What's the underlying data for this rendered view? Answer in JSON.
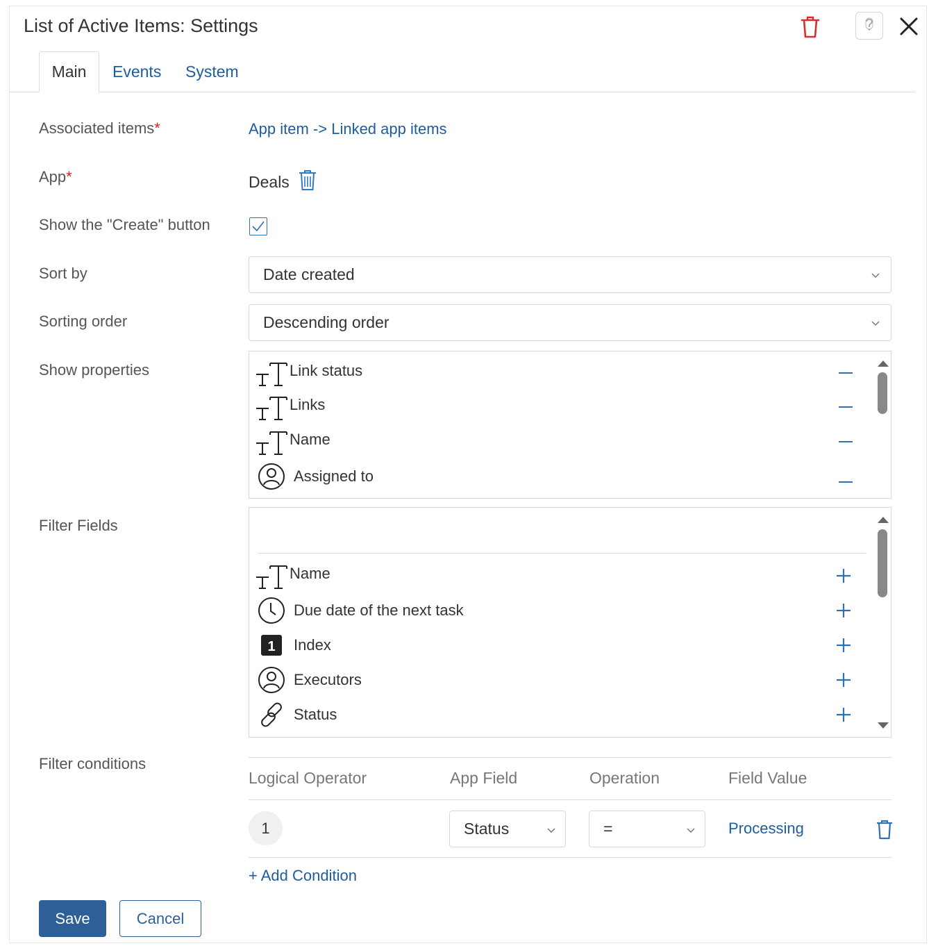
{
  "dialog": {
    "title": "List of Active Items: Settings",
    "delete_icon": "trash-icon",
    "help_icon": "question-icon",
    "close_icon": "close-icon"
  },
  "tabs": [
    {
      "label": "Main",
      "active": true
    },
    {
      "label": "Events",
      "active": false
    },
    {
      "label": "System",
      "active": false
    }
  ],
  "form": {
    "associated_items": {
      "label": "Associated items",
      "required": "*",
      "value": "App item -> Linked app items"
    },
    "app": {
      "label": "App",
      "required": "*",
      "value": "Deals"
    },
    "show_create": {
      "label": "Show the \"Create\" button",
      "checked": true
    },
    "sort_by": {
      "label": "Sort by",
      "value": "Date created"
    },
    "sorting_order": {
      "label": "Sorting order",
      "value": "Descending order"
    },
    "show_properties": {
      "label": "Show properties",
      "items": [
        {
          "icon": "text-type-icon",
          "label": "Link status"
        },
        {
          "icon": "text-type-icon",
          "label": "Links"
        },
        {
          "icon": "text-type-icon",
          "label": "Name"
        },
        {
          "icon": "user-icon",
          "label": "Assigned to"
        }
      ]
    },
    "filter_fields": {
      "label": "Filter Fields",
      "items": [
        {
          "icon": "text-type-icon",
          "label": "Name"
        },
        {
          "icon": "clock-icon",
          "label": "Due date of the next task"
        },
        {
          "icon": "number-icon",
          "label": "Index",
          "glyph": "1"
        },
        {
          "icon": "user-icon",
          "label": "Executors"
        },
        {
          "icon": "link-icon",
          "label": "Status"
        }
      ]
    },
    "filter_conditions": {
      "label": "Filter conditions",
      "headers": [
        "Logical Operator",
        "App Field",
        "Operation",
        "Field Value"
      ],
      "rows": [
        {
          "index": "1",
          "app_field": "Status",
          "operation": "=",
          "field_value": "Processing"
        }
      ],
      "add_label": "+ Add Condition"
    }
  },
  "buttons": {
    "save": "Save",
    "cancel": "Cancel"
  },
  "colors": {
    "accent": "#1e5c9e",
    "primary_button": "#2e5f98",
    "required": "#dd2222",
    "delete": "#d32f2f"
  }
}
